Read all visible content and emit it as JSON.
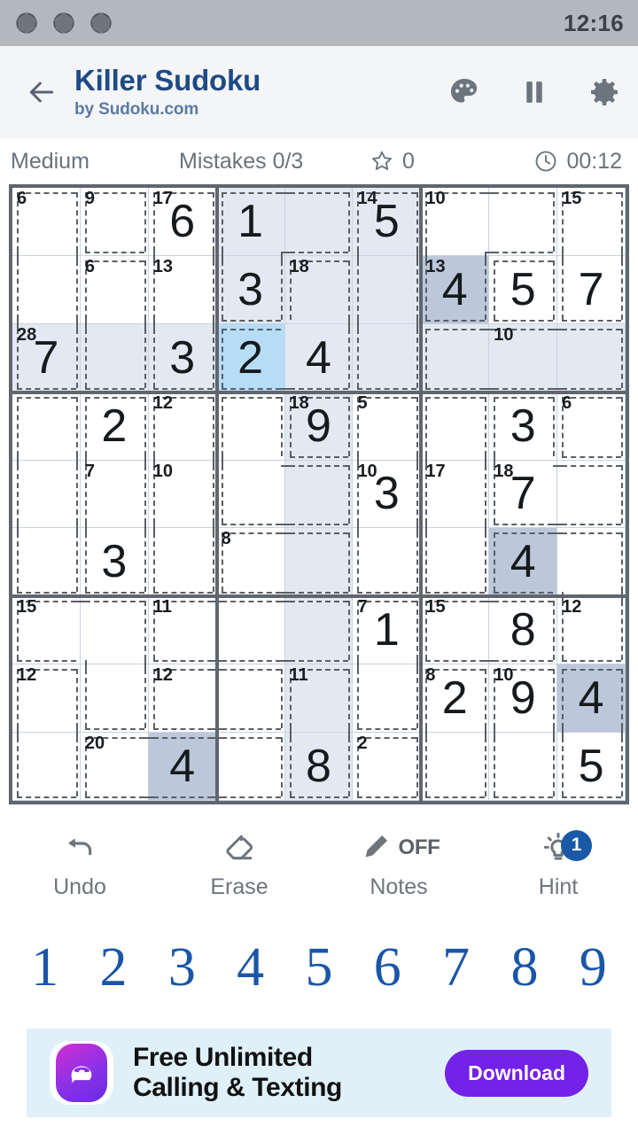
{
  "status_bar": {
    "icons": [
      "aperture-icon",
      "aperture-icon",
      "aperture-icon"
    ],
    "time": "12:16"
  },
  "app_bar": {
    "back_icon": "back-arrow-icon",
    "title": "Killer Sudoku",
    "subtitle": "by Sudoku.com",
    "actions": [
      {
        "name": "theme-palette-icon",
        "label": "palette"
      },
      {
        "name": "pause-icon",
        "label": "pause"
      },
      {
        "name": "settings-gear-icon",
        "label": "settings"
      }
    ]
  },
  "info_bar": {
    "difficulty": "Medium",
    "mistakes": "Mistakes 0/3",
    "score": "0",
    "timer": "00:12",
    "star_icon": "star-icon",
    "clock_icon": "clock-icon"
  },
  "board": {
    "size": 9,
    "selected_cell": {
      "row": 2,
      "col": 3
    },
    "selected_value": "4",
    "values": [
      [
        "",
        "",
        "6",
        "1",
        "",
        "5",
        "",
        "",
        ""
      ],
      [
        "",
        "",
        "",
        "3",
        "",
        "",
        "4",
        "5",
        "7"
      ],
      [
        "7",
        "",
        "3",
        "2",
        "4",
        "",
        "",
        "",
        ""
      ],
      [
        "",
        "2",
        "",
        "",
        "9",
        "",
        "",
        "3",
        ""
      ],
      [
        "",
        "",
        "",
        "",
        "",
        "3",
        "",
        "7",
        ""
      ],
      [
        "",
        "3",
        "",
        "",
        "",
        "",
        "",
        "4",
        ""
      ],
      [
        "",
        "",
        "",
        "",
        "",
        "1",
        "",
        "8",
        ""
      ],
      [
        "",
        "",
        "",
        "",
        "",
        "",
        "2",
        "9",
        "4"
      ],
      [
        "",
        "",
        "4",
        "",
        "8",
        "",
        "",
        "",
        "5"
      ]
    ],
    "cage_sums": [
      {
        "row": 0,
        "col": 0,
        "sum": "6"
      },
      {
        "row": 0,
        "col": 1,
        "sum": "9"
      },
      {
        "row": 0,
        "col": 2,
        "sum": "17"
      },
      {
        "row": 0,
        "col": 5,
        "sum": "14"
      },
      {
        "row": 0,
        "col": 6,
        "sum": "10"
      },
      {
        "row": 0,
        "col": 8,
        "sum": "15"
      },
      {
        "row": 1,
        "col": 1,
        "sum": "6"
      },
      {
        "row": 1,
        "col": 2,
        "sum": "13"
      },
      {
        "row": 1,
        "col": 4,
        "sum": "18"
      },
      {
        "row": 1,
        "col": 6,
        "sum": "13"
      },
      {
        "row": 2,
        "col": 0,
        "sum": "28"
      },
      {
        "row": 2,
        "col": 7,
        "sum": "10"
      },
      {
        "row": 3,
        "col": 2,
        "sum": "12"
      },
      {
        "row": 3,
        "col": 4,
        "sum": "18"
      },
      {
        "row": 3,
        "col": 5,
        "sum": "5"
      },
      {
        "row": 3,
        "col": 8,
        "sum": "6"
      },
      {
        "row": 4,
        "col": 1,
        "sum": "7"
      },
      {
        "row": 4,
        "col": 2,
        "sum": "10"
      },
      {
        "row": 4,
        "col": 5,
        "sum": "10"
      },
      {
        "row": 4,
        "col": 6,
        "sum": "17"
      },
      {
        "row": 4,
        "col": 7,
        "sum": "18"
      },
      {
        "row": 5,
        "col": 3,
        "sum": "8"
      },
      {
        "row": 6,
        "col": 0,
        "sum": "15"
      },
      {
        "row": 6,
        "col": 2,
        "sum": "11"
      },
      {
        "row": 6,
        "col": 5,
        "sum": "7"
      },
      {
        "row": 6,
        "col": 6,
        "sum": "15"
      },
      {
        "row": 6,
        "col": 8,
        "sum": "12"
      },
      {
        "row": 7,
        "col": 0,
        "sum": "12"
      },
      {
        "row": 7,
        "col": 2,
        "sum": "12"
      },
      {
        "row": 7,
        "col": 4,
        "sum": "11"
      },
      {
        "row": 7,
        "col": 6,
        "sum": "8"
      },
      {
        "row": 7,
        "col": 7,
        "sum": "10"
      },
      {
        "row": 8,
        "col": 1,
        "sum": "20"
      },
      {
        "row": 8,
        "col": 5,
        "sum": "2"
      }
    ],
    "cages": [
      [
        [
          0,
          0
        ],
        [
          1,
          0
        ],
        [
          2,
          0
        ]
      ],
      [
        [
          0,
          1
        ]
      ],
      [
        [
          0,
          2
        ],
        [
          1,
          2
        ],
        [
          2,
          2
        ]
      ],
      [
        [
          0,
          3
        ],
        [
          0,
          4
        ],
        [
          1,
          3
        ]
      ],
      [
        [
          0,
          5
        ],
        [
          1,
          5
        ],
        [
          2,
          5
        ]
      ],
      [
        [
          0,
          6
        ],
        [
          0,
          7
        ],
        [
          1,
          6
        ]
      ],
      [
        [
          0,
          8
        ],
        [
          1,
          8
        ]
      ],
      [
        [
          1,
          1
        ],
        [
          2,
          1
        ]
      ],
      [
        [
          1,
          4
        ],
        [
          2,
          4
        ],
        [
          2,
          3
        ]
      ],
      [
        [
          1,
          7
        ]
      ],
      [
        [
          2,
          6
        ],
        [
          2,
          7
        ],
        [
          2,
          8
        ]
      ],
      [
        [
          3,
          0
        ],
        [
          4,
          0
        ],
        [
          5,
          0
        ]
      ],
      [
        [
          3,
          1
        ],
        [
          4,
          1
        ],
        [
          5,
          1
        ]
      ],
      [
        [
          3,
          2
        ],
        [
          4,
          2
        ],
        [
          5,
          2
        ]
      ],
      [
        [
          3,
          3
        ],
        [
          4,
          3
        ],
        [
          4,
          4
        ]
      ],
      [
        [
          3,
          4
        ]
      ],
      [
        [
          3,
          5
        ],
        [
          4,
          5
        ],
        [
          5,
          5
        ]
      ],
      [
        [
          3,
          6
        ],
        [
          4,
          6
        ],
        [
          5,
          6
        ]
      ],
      [
        [
          3,
          7
        ],
        [
          4,
          7
        ],
        [
          4,
          8
        ]
      ],
      [
        [
          3,
          8
        ]
      ],
      [
        [
          5,
          3
        ],
        [
          5,
          4
        ]
      ],
      [
        [
          5,
          7
        ],
        [
          5,
          8
        ],
        [
          6,
          8
        ]
      ],
      [
        [
          6,
          0
        ],
        [
          6,
          1
        ],
        [
          7,
          1
        ]
      ],
      [
        [
          6,
          2
        ],
        [
          6,
          3
        ],
        [
          6,
          4
        ]
      ],
      [
        [
          6,
          5
        ],
        [
          7,
          5
        ]
      ],
      [
        [
          6,
          6
        ],
        [
          6,
          7
        ]
      ],
      [
        [
          7,
          0
        ],
        [
          8,
          0
        ]
      ],
      [
        [
          7,
          2
        ],
        [
          7,
          3
        ]
      ],
      [
        [
          7,
          4
        ],
        [
          8,
          4
        ]
      ],
      [
        [
          7,
          6
        ],
        [
          8,
          6
        ]
      ],
      [
        [
          7,
          7
        ],
        [
          8,
          7
        ]
      ],
      [
        [
          7,
          8
        ],
        [
          8,
          8
        ]
      ],
      [
        [
          8,
          1
        ],
        [
          8,
          2
        ],
        [
          8,
          3
        ]
      ],
      [
        [
          8,
          5
        ]
      ]
    ],
    "highlight_units": {
      "row": 2,
      "col": 4,
      "box_row_start": 0,
      "box_col_start": 3
    },
    "same_value_cells": [
      [
        1,
        6
      ],
      [
        5,
        7
      ],
      [
        7,
        8
      ],
      [
        8,
        2
      ]
    ],
    "colors": {
      "selected": "#b6dcf7",
      "unit_highlight": "#e3e9f2",
      "same_value_highlight": "#bcc8da",
      "grid_thick": "#5f666e",
      "grid_thin": "#c8d2e0",
      "cage_dash": "#5a5f66",
      "digit": "#161a1d"
    }
  },
  "toolbar": [
    {
      "name": "undo-button",
      "icon": "undo-arrow-icon",
      "label": "Undo",
      "state": ""
    },
    {
      "name": "erase-button",
      "icon": "eraser-icon",
      "label": "Erase",
      "state": ""
    },
    {
      "name": "notes-button",
      "icon": "pencil-icon",
      "label": "Notes",
      "state": "OFF"
    },
    {
      "name": "hint-button",
      "icon": "lightbulb-icon",
      "label": "Hint",
      "badge": "1"
    }
  ],
  "numpad": [
    "1",
    "2",
    "3",
    "4",
    "5",
    "6",
    "7",
    "8",
    "9"
  ],
  "ad": {
    "logo_icon": "chat-phone-icon",
    "line1": "Free Unlimited",
    "line2": "Calling & Texting",
    "button": "Download"
  }
}
